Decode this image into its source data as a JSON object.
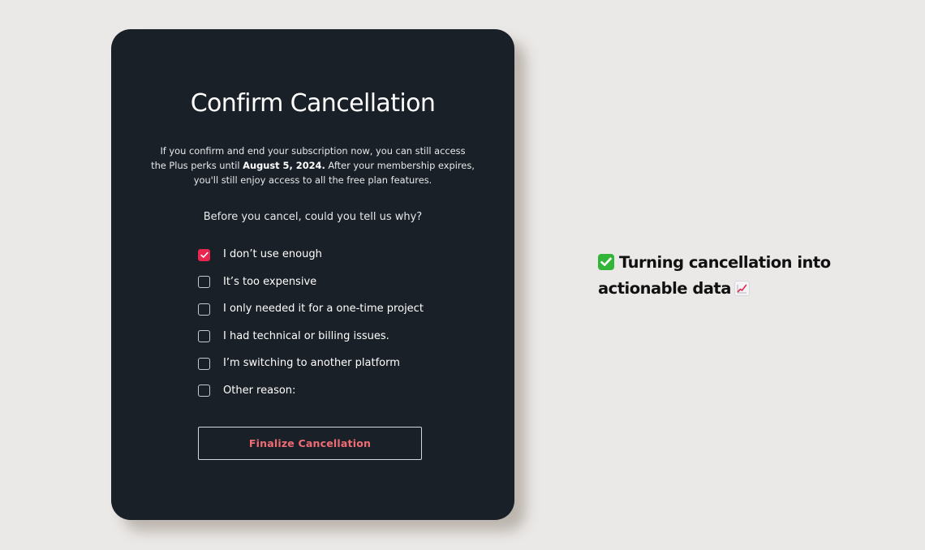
{
  "modal": {
    "title": "Confirm Cancellation",
    "description": {
      "line1": "If you confirm and end your subscription now, you can still access",
      "line2_prefix": "the Plus perks until ",
      "date": "August 5, 2024.",
      "line2_suffix": " After your membership expires,",
      "line3": "you'll still enjoy access to all the free plan features."
    },
    "prompt": "Before you cancel, could you tell us why?",
    "reasons": [
      {
        "label": "I don’t use enough",
        "checked": true
      },
      {
        "label": "It’s too expensive",
        "checked": false
      },
      {
        "label": "I only needed it for a one-time project",
        "checked": false
      },
      {
        "label": "I had technical or billing issues.",
        "checked": false
      },
      {
        "label": "I’m switching to another platform",
        "checked": false
      },
      {
        "label": "Other reason:",
        "checked": false
      }
    ],
    "finalize_label": "Finalize Cancellation"
  },
  "caption": {
    "line1": "Turning cancellation into",
    "line2": "actionable data",
    "lead_icon": "check-mark-button-emoji",
    "trail_icon": "chart-increasing-emoji"
  },
  "colors": {
    "background": "#ebe9e7",
    "modal": "#1a2027",
    "accent": "#e8264f",
    "button_text": "#f06c74"
  }
}
